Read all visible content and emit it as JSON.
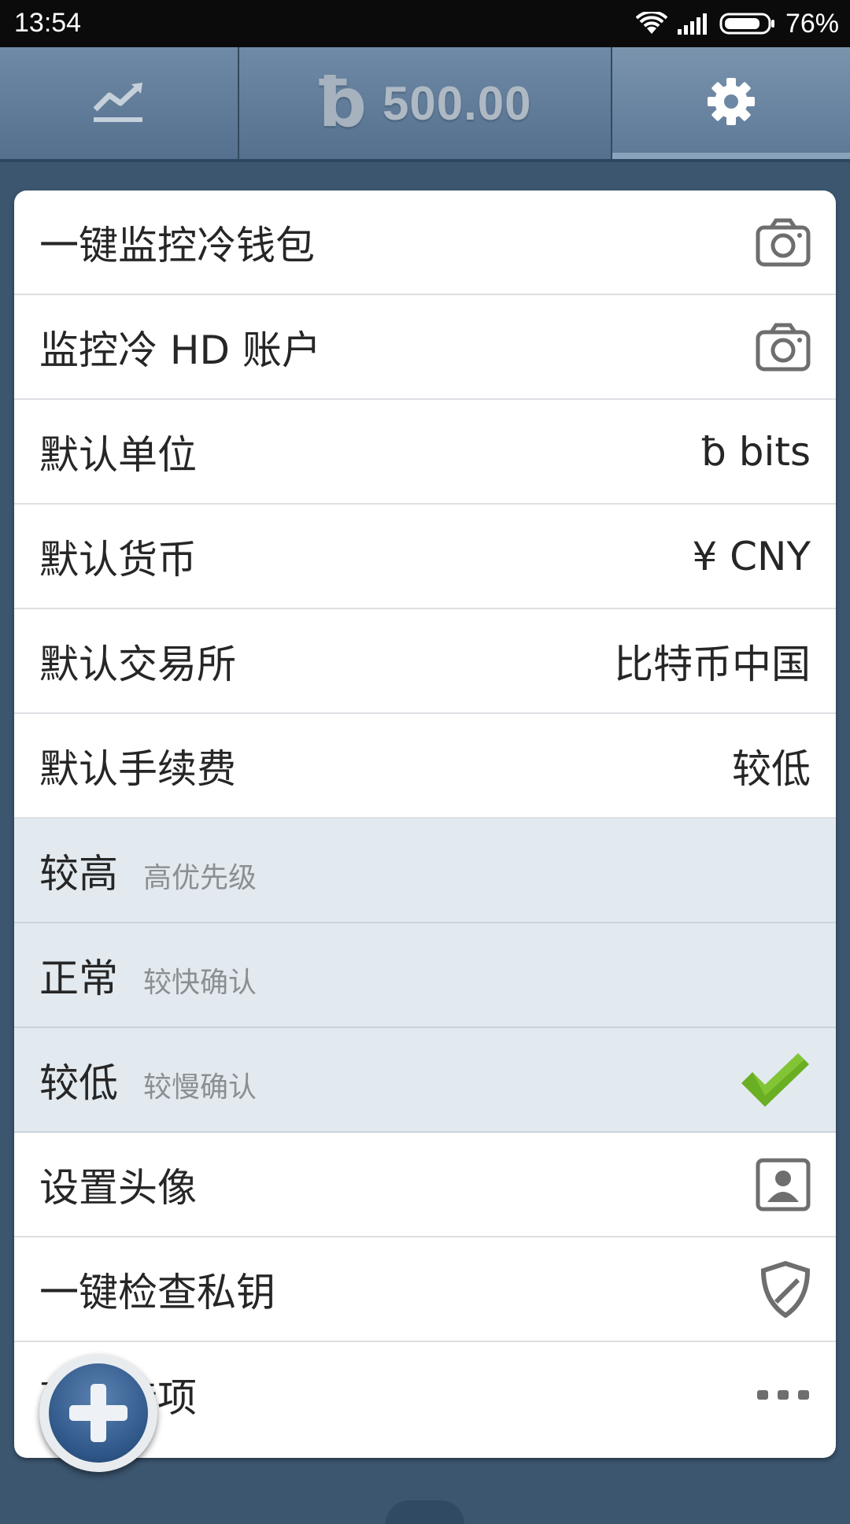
{
  "status_bar": {
    "time": "13:54",
    "battery_percent": "76%"
  },
  "header": {
    "tabs": [
      {
        "name": "chart-tab",
        "icon": "trend-chart-icon"
      },
      {
        "name": "balance-tab",
        "icon": "bits-currency-icon",
        "balance": "500.00"
      },
      {
        "name": "settings-tab",
        "icon": "gear-icon",
        "active": true
      }
    ],
    "bits_symbol": "ƀ"
  },
  "settings": {
    "items": [
      {
        "label": "一键监控冷钱包",
        "icon": "camera-icon"
      },
      {
        "label": "监控冷 HD 账户",
        "icon": "camera-icon"
      },
      {
        "label": "默认单位",
        "value": "ƀ bits"
      },
      {
        "label": "默认货币",
        "value": "¥ CNY"
      },
      {
        "label": "默认交易所",
        "value": "比特币中国"
      },
      {
        "label": "默认手续费",
        "value": "较低"
      }
    ],
    "fee_options": [
      {
        "label": "较高",
        "desc": "高优先级",
        "selected": false
      },
      {
        "label": "正常",
        "desc": "较快确认",
        "selected": false
      },
      {
        "label": "较低",
        "desc": "较慢确认",
        "selected": true
      }
    ],
    "more_items": [
      {
        "label": "设置头像",
        "icon": "avatar-icon"
      },
      {
        "label": "一键检查私钥",
        "icon": "shield-icon"
      },
      {
        "label": "高级选项",
        "icon": "more-dots-icon"
      }
    ]
  },
  "colors": {
    "background": "#3c5670",
    "header": "#6f8aa6",
    "selected_row": "#e2eaf0",
    "check": "#6aae24",
    "fab": "#2e5687"
  },
  "fab": {
    "icon": "plus-icon"
  }
}
